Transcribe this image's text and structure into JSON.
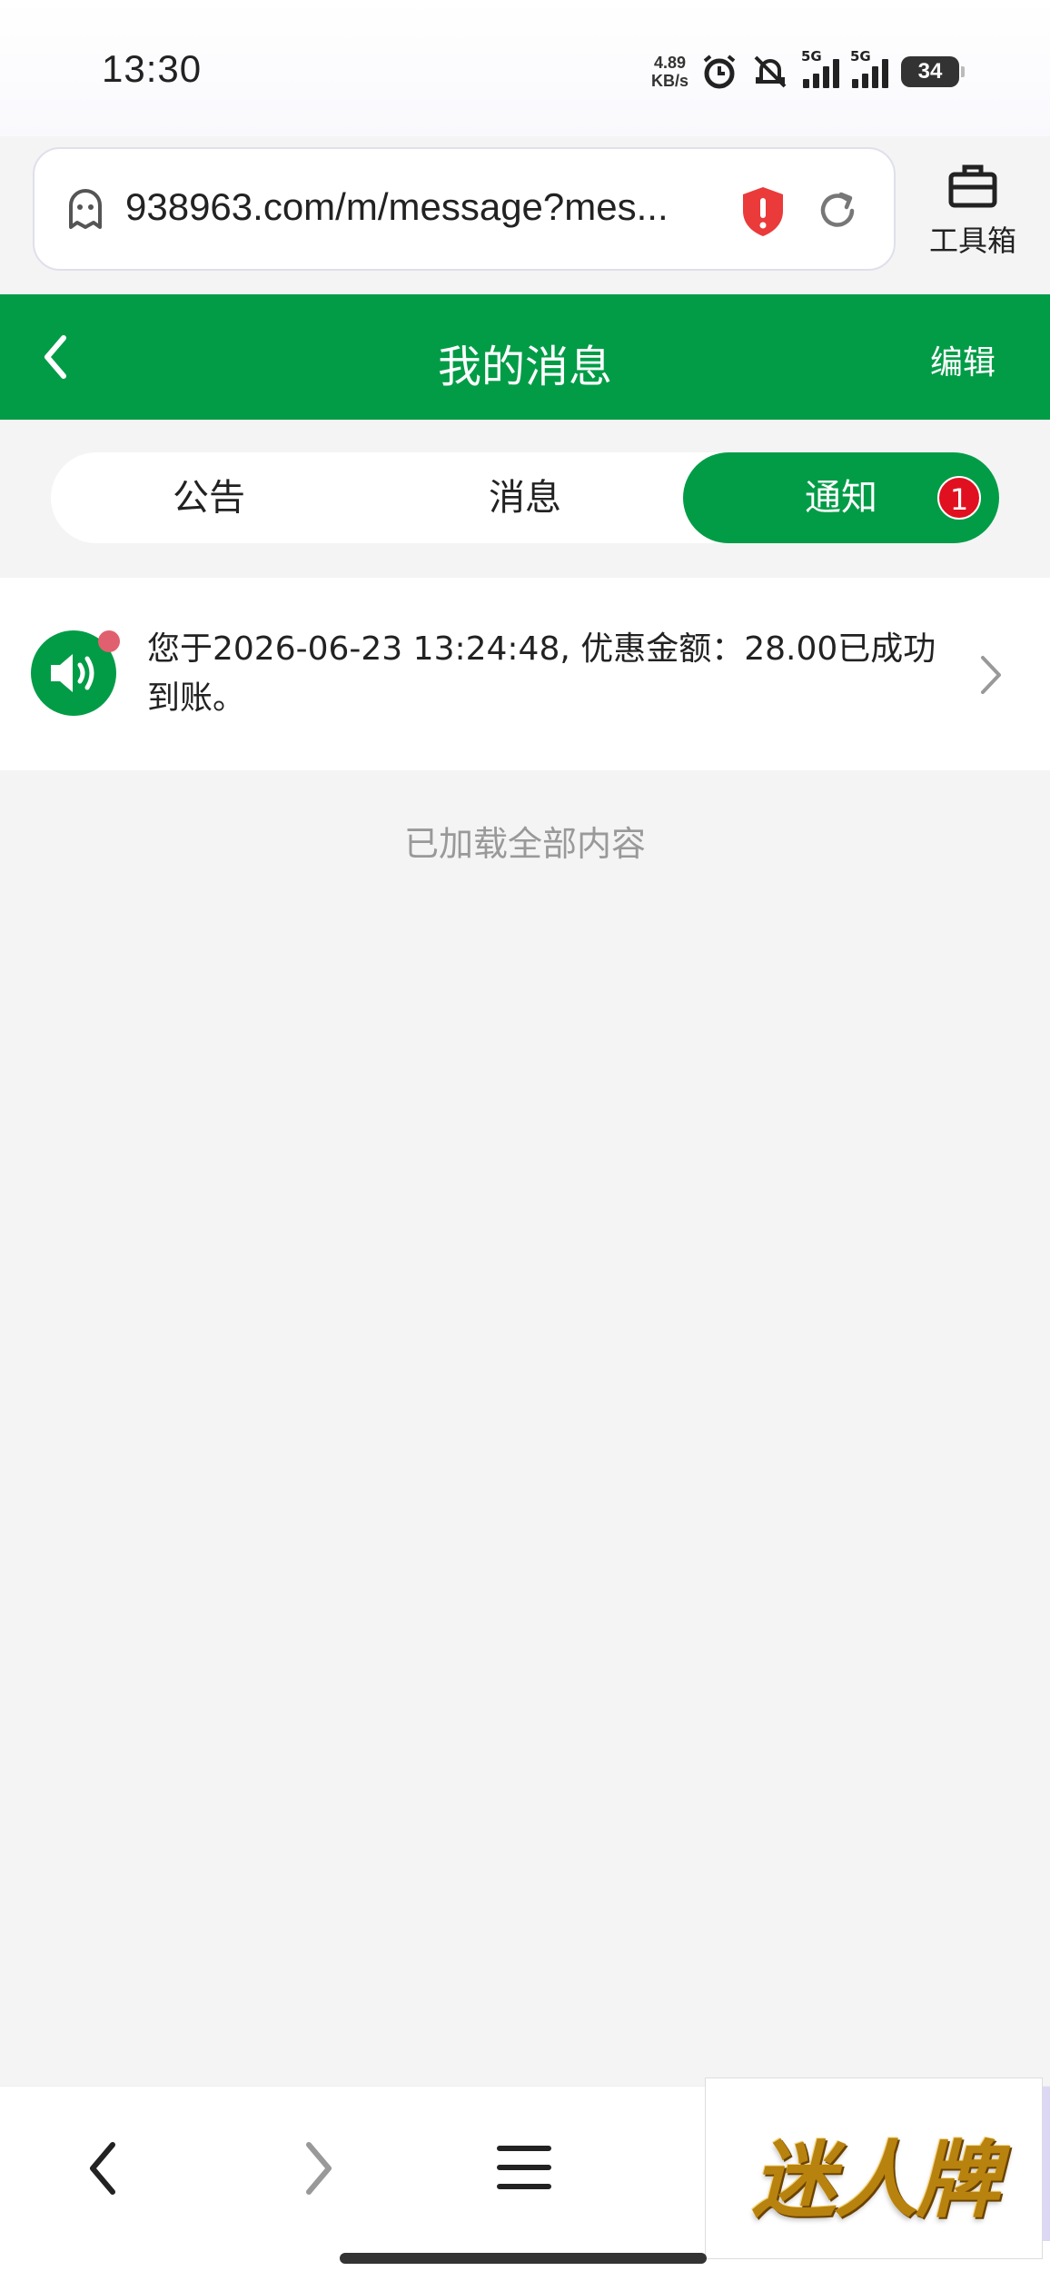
{
  "status_bar": {
    "time": "13:30",
    "net_speed_value": "4.89",
    "net_speed_unit": "KB/s",
    "signal1_tag": "5G",
    "signal2_tag": "5G",
    "battery": "34"
  },
  "browser": {
    "url": "938963.com/m/message?mes...",
    "toolbox_label": "工具箱"
  },
  "header": {
    "title": "我的消息",
    "edit_label": "编辑"
  },
  "tabs": [
    {
      "label": "公告"
    },
    {
      "label": "消息"
    },
    {
      "label": "通知",
      "badge": "1",
      "active": true
    }
  ],
  "messages": [
    {
      "text": "您于2026-06-23 13:24:48, 优惠金额：28.00已成功到账。",
      "unread": true
    }
  ],
  "footer_text": "已加载全部内容",
  "ad": {
    "logo_text": "迷人牌"
  },
  "colors": {
    "brand_green": "#029c47",
    "badge_red": "#e01020",
    "page_bg": "#f4f4f4"
  }
}
